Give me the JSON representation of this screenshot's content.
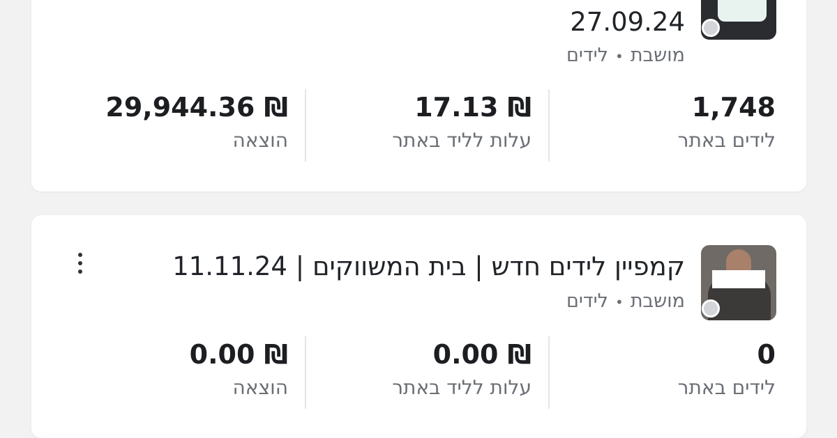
{
  "campaigns": [
    {
      "title": "27.09.24",
      "meta": {
        "status": "מושבת",
        "objective": "לידים",
        "separator": "•"
      },
      "stats": [
        {
          "label": "לידים באתר",
          "value": "1,748"
        },
        {
          "label": "עלות לליד באתר",
          "value": "17.13",
          "currency": "₪"
        },
        {
          "label": "הוצאה",
          "value": "29,944.36",
          "currency": "₪"
        }
      ]
    },
    {
      "title": "קמפיין לידים חדש | בית המשווקים | 11.11.24",
      "meta": {
        "status": "מושבת",
        "objective": "לידים",
        "separator": "•"
      },
      "stats": [
        {
          "label": "לידים באתר",
          "value": "0"
        },
        {
          "label": "עלות לליד באתר",
          "value": "0.00",
          "currency": "₪"
        },
        {
          "label": "הוצאה",
          "value": "0.00",
          "currency": "₪"
        }
      ]
    }
  ],
  "icons": {
    "thumbnail": "campaign-thumbnail",
    "status": "status-dot-icon",
    "menu": "more-vertical-icon"
  },
  "colors": {
    "background": "#f2f2f3",
    "card": "#ffffff",
    "text_primary": "#1c1e21",
    "text_secondary": "#6a6e74",
    "status_inactive": "#d3d5d8"
  }
}
